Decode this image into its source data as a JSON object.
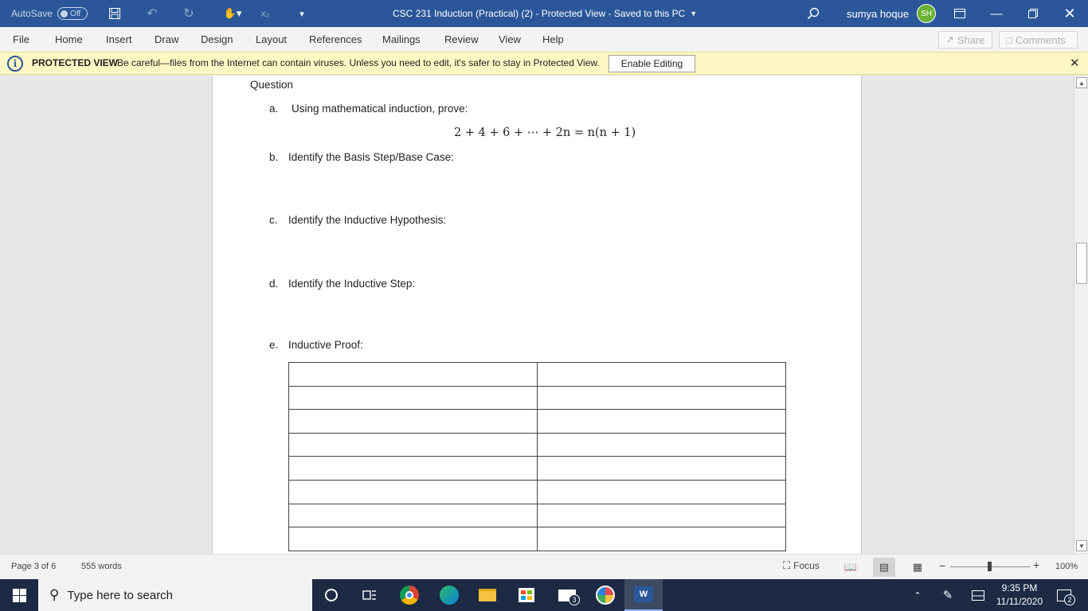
{
  "titlebar": {
    "autosave_label": "AutoSave",
    "autosave_state": "Off",
    "doc_title": "CSC 231 Induction (Practical) (2)  -  Protected View  -  Saved to this PC",
    "user_name": "sumya hoque",
    "user_initials": "SH"
  },
  "menu": {
    "items": [
      "File",
      "Home",
      "Insert",
      "Draw",
      "Design",
      "Layout",
      "References",
      "Mailings",
      "Review",
      "View",
      "Help"
    ],
    "share_label": "Share",
    "comments_label": "Comments"
  },
  "protected_view": {
    "title": "PROTECTED VIEW",
    "message": "Be careful—files from the Internet can contain viruses. Unless you need to edit, it's safer to stay in Protected View.",
    "button_label": "Enable Editing"
  },
  "document": {
    "heading": "Question",
    "items": [
      {
        "letter": "a.",
        "text": "Using mathematical induction, prove:"
      },
      {
        "letter": "b.",
        "text": "Identify the Basis Step/Base Case:"
      },
      {
        "letter": "c.",
        "text": "Identify the Inductive Hypothesis:"
      },
      {
        "letter": "d.",
        "text": "Identify the Inductive Step:"
      },
      {
        "letter": "e.",
        "text": "Inductive Proof:"
      }
    ],
    "equation": "2 + 4 + 6 + ⋯ + 2n = n(n + 1)",
    "table_rows": 8,
    "table_cols": 2
  },
  "statusbar": {
    "page": "Page 3 of 6",
    "words": "555 words",
    "focus_label": "Focus",
    "zoom": "100%",
    "zoom_minus": "−",
    "zoom_plus": "+"
  },
  "taskbar": {
    "search_placeholder": "Type here to search",
    "mail_badge": "3",
    "time": "9:35 PM",
    "date": "11/11/2020",
    "notification_count": "2"
  },
  "colors": {
    "title_bar": "#2b579a",
    "protected_bar": "#fdf7c3",
    "taskbar": "#1c2a44",
    "avatar": "#6bb036"
  }
}
